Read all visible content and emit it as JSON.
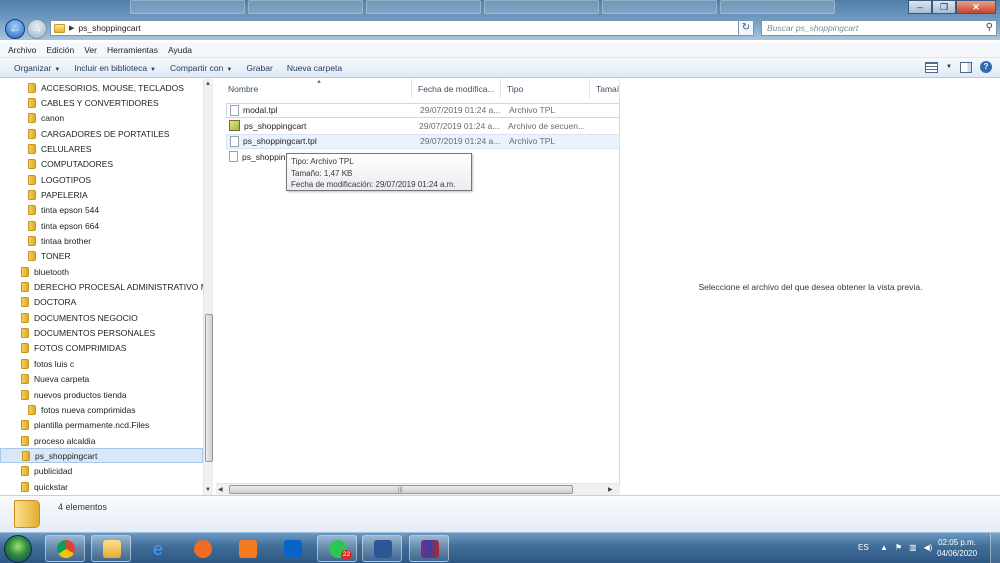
{
  "window": {
    "address_path": "ps_shoppingcart",
    "search_placeholder": "Buscar ps_shoppingcart"
  },
  "menubar": [
    "Archivo",
    "Edición",
    "Ver",
    "Herramientas",
    "Ayuda"
  ],
  "toolbar": {
    "organize": "Organizar",
    "include_library": "Incluir en biblioteca",
    "share_with": "Compartir con",
    "burn": "Grabar",
    "new_folder": "Nueva carpeta"
  },
  "nav_tree": [
    {
      "label": "ACCESORIOS, MOUSE, TECLADOS",
      "indent": 1
    },
    {
      "label": "CABLES Y CONVERTIDORES",
      "indent": 1
    },
    {
      "label": "canon",
      "indent": 1
    },
    {
      "label": "CARGADORES DE PORTATILES",
      "indent": 1
    },
    {
      "label": "CELULARES",
      "indent": 1
    },
    {
      "label": "COMPUTADORES",
      "indent": 1
    },
    {
      "label": "LOGOTIPOS",
      "indent": 1
    },
    {
      "label": "PAPELERIA",
      "indent": 1
    },
    {
      "label": "tinta epson 544",
      "indent": 1
    },
    {
      "label": "tinta epson 664",
      "indent": 1
    },
    {
      "label": "tintaa brother",
      "indent": 1
    },
    {
      "label": "TONER",
      "indent": 1
    },
    {
      "label": "bluetooth",
      "indent": 0
    },
    {
      "label": "DERECHO PROCESAL ADMINISTRATIVO M",
      "indent": 0
    },
    {
      "label": "DOCTORA",
      "indent": 0
    },
    {
      "label": "DOCUMENTOS NEGOCIO",
      "indent": 0
    },
    {
      "label": "DOCUMENTOS PERSONALES",
      "indent": 0
    },
    {
      "label": "FOTOS COMPRIMIDAS",
      "indent": 0
    },
    {
      "label": "fotos luis c",
      "indent": 0
    },
    {
      "label": "Nueva carpeta",
      "indent": 0
    },
    {
      "label": "nuevos productos tienda",
      "indent": 0
    },
    {
      "label": "fotos nueva comprimidas",
      "indent": 1
    },
    {
      "label": "plantilla permamente.ncd.Files",
      "indent": 0
    },
    {
      "label": "proceso alcaldia",
      "indent": 0
    },
    {
      "label": "ps_shoppingcart",
      "indent": 0,
      "selected": true
    },
    {
      "label": "publicidad",
      "indent": 0
    },
    {
      "label": "quickstar",
      "indent": 0
    }
  ],
  "columns": {
    "name": "Nombre",
    "modified": "Fecha de modifica...",
    "type": "Tipo",
    "size": "Tamaí"
  },
  "files": [
    {
      "name": "modal.tpl",
      "modified": "29/07/2019 01:24 a...",
      "type": "Archivo TPL",
      "icon": "document-icon"
    },
    {
      "name": "ps_shoppingcart",
      "modified": "29/07/2019 01:24 a...",
      "type": "Archivo de secuen...",
      "icon": "script-icon"
    },
    {
      "name": "ps_shoppingcart.tpl",
      "modified": "29/07/2019 01:24 a...",
      "type": "Archivo TPL",
      "icon": "document-icon"
    },
    {
      "name": "ps_shoppin",
      "modified": "",
      "type": "",
      "icon": "document-icon"
    }
  ],
  "tooltip": {
    "line1": "Tipo: Archivo TPL",
    "line2": "Tamaño: 1,47 KB",
    "line3": "Fecha de modificación: 29/07/2019 01:24 a.m."
  },
  "preview_message": "Seleccione el archivo del que desea obtener la vista previa.",
  "details": {
    "item_count": "4 elementos"
  },
  "taskbar": {
    "whatsapp_badge": "22",
    "language": "ES",
    "time": "02:05 p.m.",
    "date": "04/06/2020"
  },
  "colors": {
    "accent": "#2f6cb5",
    "selection": "#d9e8f8",
    "taskbar": "#3f6d98"
  }
}
